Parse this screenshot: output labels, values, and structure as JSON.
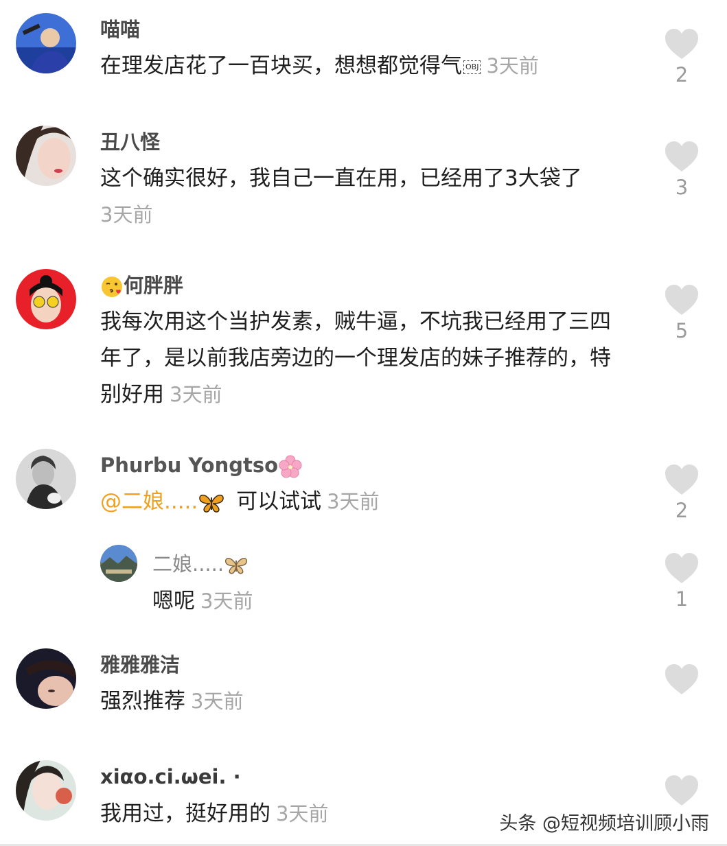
{
  "comments": [
    {
      "username": "喵喵",
      "text": "在理发店花了一百块买，想想都觉得气",
      "obj_label": "OBJ",
      "time": "3天前",
      "likes": "2"
    },
    {
      "username": "丑八怪",
      "text": "这个确实很好，我自己一直在用，已经用了3大袋了",
      "time": "3天前",
      "likes": "3"
    },
    {
      "username": "何胖胖",
      "text": "我每次用这个当护发素，贼牛逼，不坑我已经用了三四年了，是以前我店旁边的一个理发店的妹子推荐的，特别好用",
      "time": "3天前",
      "likes": "5"
    },
    {
      "username": "Phurbu Yongtso",
      "mention": "@二娘.....",
      "text": "可以试试",
      "time": "3天前",
      "likes": "2"
    },
    {
      "username": "二娘.....",
      "text": "嗯呢",
      "time": "3天前",
      "likes": "1"
    },
    {
      "username": "雅雅雅洁",
      "text": "强烈推荐",
      "time": "3天前",
      "likes": ""
    },
    {
      "username": "xiαo.ci.ωei. ·",
      "text": "我用过，挺好用的",
      "time": "3天前",
      "likes": ""
    }
  ],
  "watermark": "头条 @短视频培训顾小雨",
  "colors": {
    "heart": "#dcdcdc",
    "mention": "#f0a020",
    "time": "#a6a6a6"
  }
}
